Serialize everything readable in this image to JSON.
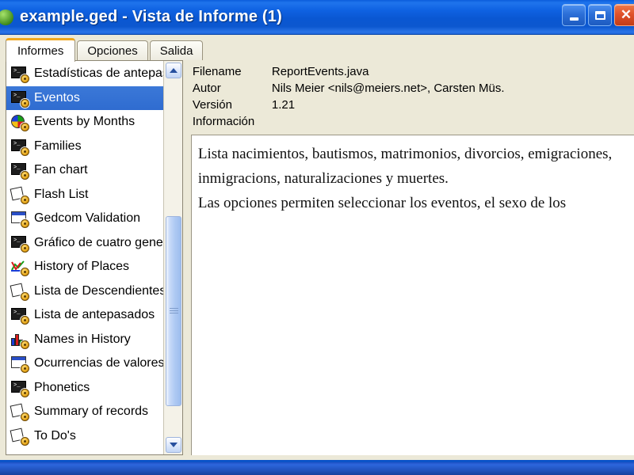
{
  "window": {
    "title": "example.ged - Vista de Informe (1)",
    "app_icon": "genj-globe-icon",
    "buttons": {
      "minimize": "minimize-button",
      "maximize": "maximize-button",
      "close_label": "✕"
    }
  },
  "tabs": [
    {
      "label": "Informes",
      "active": true
    },
    {
      "label": "Opciones",
      "active": false
    },
    {
      "label": "Salida",
      "active": false
    }
  ],
  "report_list": [
    {
      "label": "Estadísticas de antepasados",
      "icon": "console-report-icon",
      "selected": false
    },
    {
      "label": "Eventos",
      "icon": "console-report-icon",
      "selected": true
    },
    {
      "label": "Events by Months",
      "icon": "pie-chart-report-icon",
      "selected": false
    },
    {
      "label": "Families",
      "icon": "console-report-icon",
      "selected": false
    },
    {
      "label": "Fan chart",
      "icon": "console-report-icon",
      "selected": false
    },
    {
      "label": "Flash List",
      "icon": "page-report-icon",
      "selected": false
    },
    {
      "label": "Gedcom Validation",
      "icon": "window-report-icon",
      "selected": false
    },
    {
      "label": "Gráfico de cuatro generaciones",
      "icon": "console-report-icon",
      "selected": false
    },
    {
      "label": "History of Places",
      "icon": "graph-report-icon",
      "selected": false
    },
    {
      "label": "Lista de Descendientes",
      "icon": "page-report-icon",
      "selected": false
    },
    {
      "label": "Lista de antepasados",
      "icon": "console-report-icon",
      "selected": false
    },
    {
      "label": "Names in History",
      "icon": "bar-chart-report-icon",
      "selected": false
    },
    {
      "label": "Ocurrencias de valores",
      "icon": "window-report-icon",
      "selected": false
    },
    {
      "label": "Phonetics",
      "icon": "console-report-icon",
      "selected": false
    },
    {
      "label": "Summary of records",
      "icon": "page-report-icon",
      "selected": false
    },
    {
      "label": "To Do's",
      "icon": "page-report-icon",
      "selected": false
    }
  ],
  "scrollbar": {
    "up_arrow": "scroll-up-icon",
    "down_arrow": "scroll-down-icon",
    "thumb": "scroll-thumb"
  },
  "details": {
    "meta": [
      {
        "key": "Filename",
        "value": "ReportEvents.java"
      },
      {
        "key": "Autor",
        "value": "Nils Meier <nils@meiers.net>, Carsten Müs."
      },
      {
        "key": "Versión",
        "value": "1.21"
      },
      {
        "key": "Información",
        "value": ""
      }
    ],
    "description": "Lista nacimientos, bautismos, matrimonios, divorcios, emigraciones, inmigracions, naturalizaciones y muertes.\nLas opciones permiten seleccionar los eventos, el sexo de los"
  },
  "colors": {
    "titlebar_blue": "#0f62e2",
    "selection_blue": "#3b78d8",
    "active_tab_accent": "#f0a81e",
    "window_face": "#ece9d8",
    "desktop_green": "#4a8a34"
  }
}
